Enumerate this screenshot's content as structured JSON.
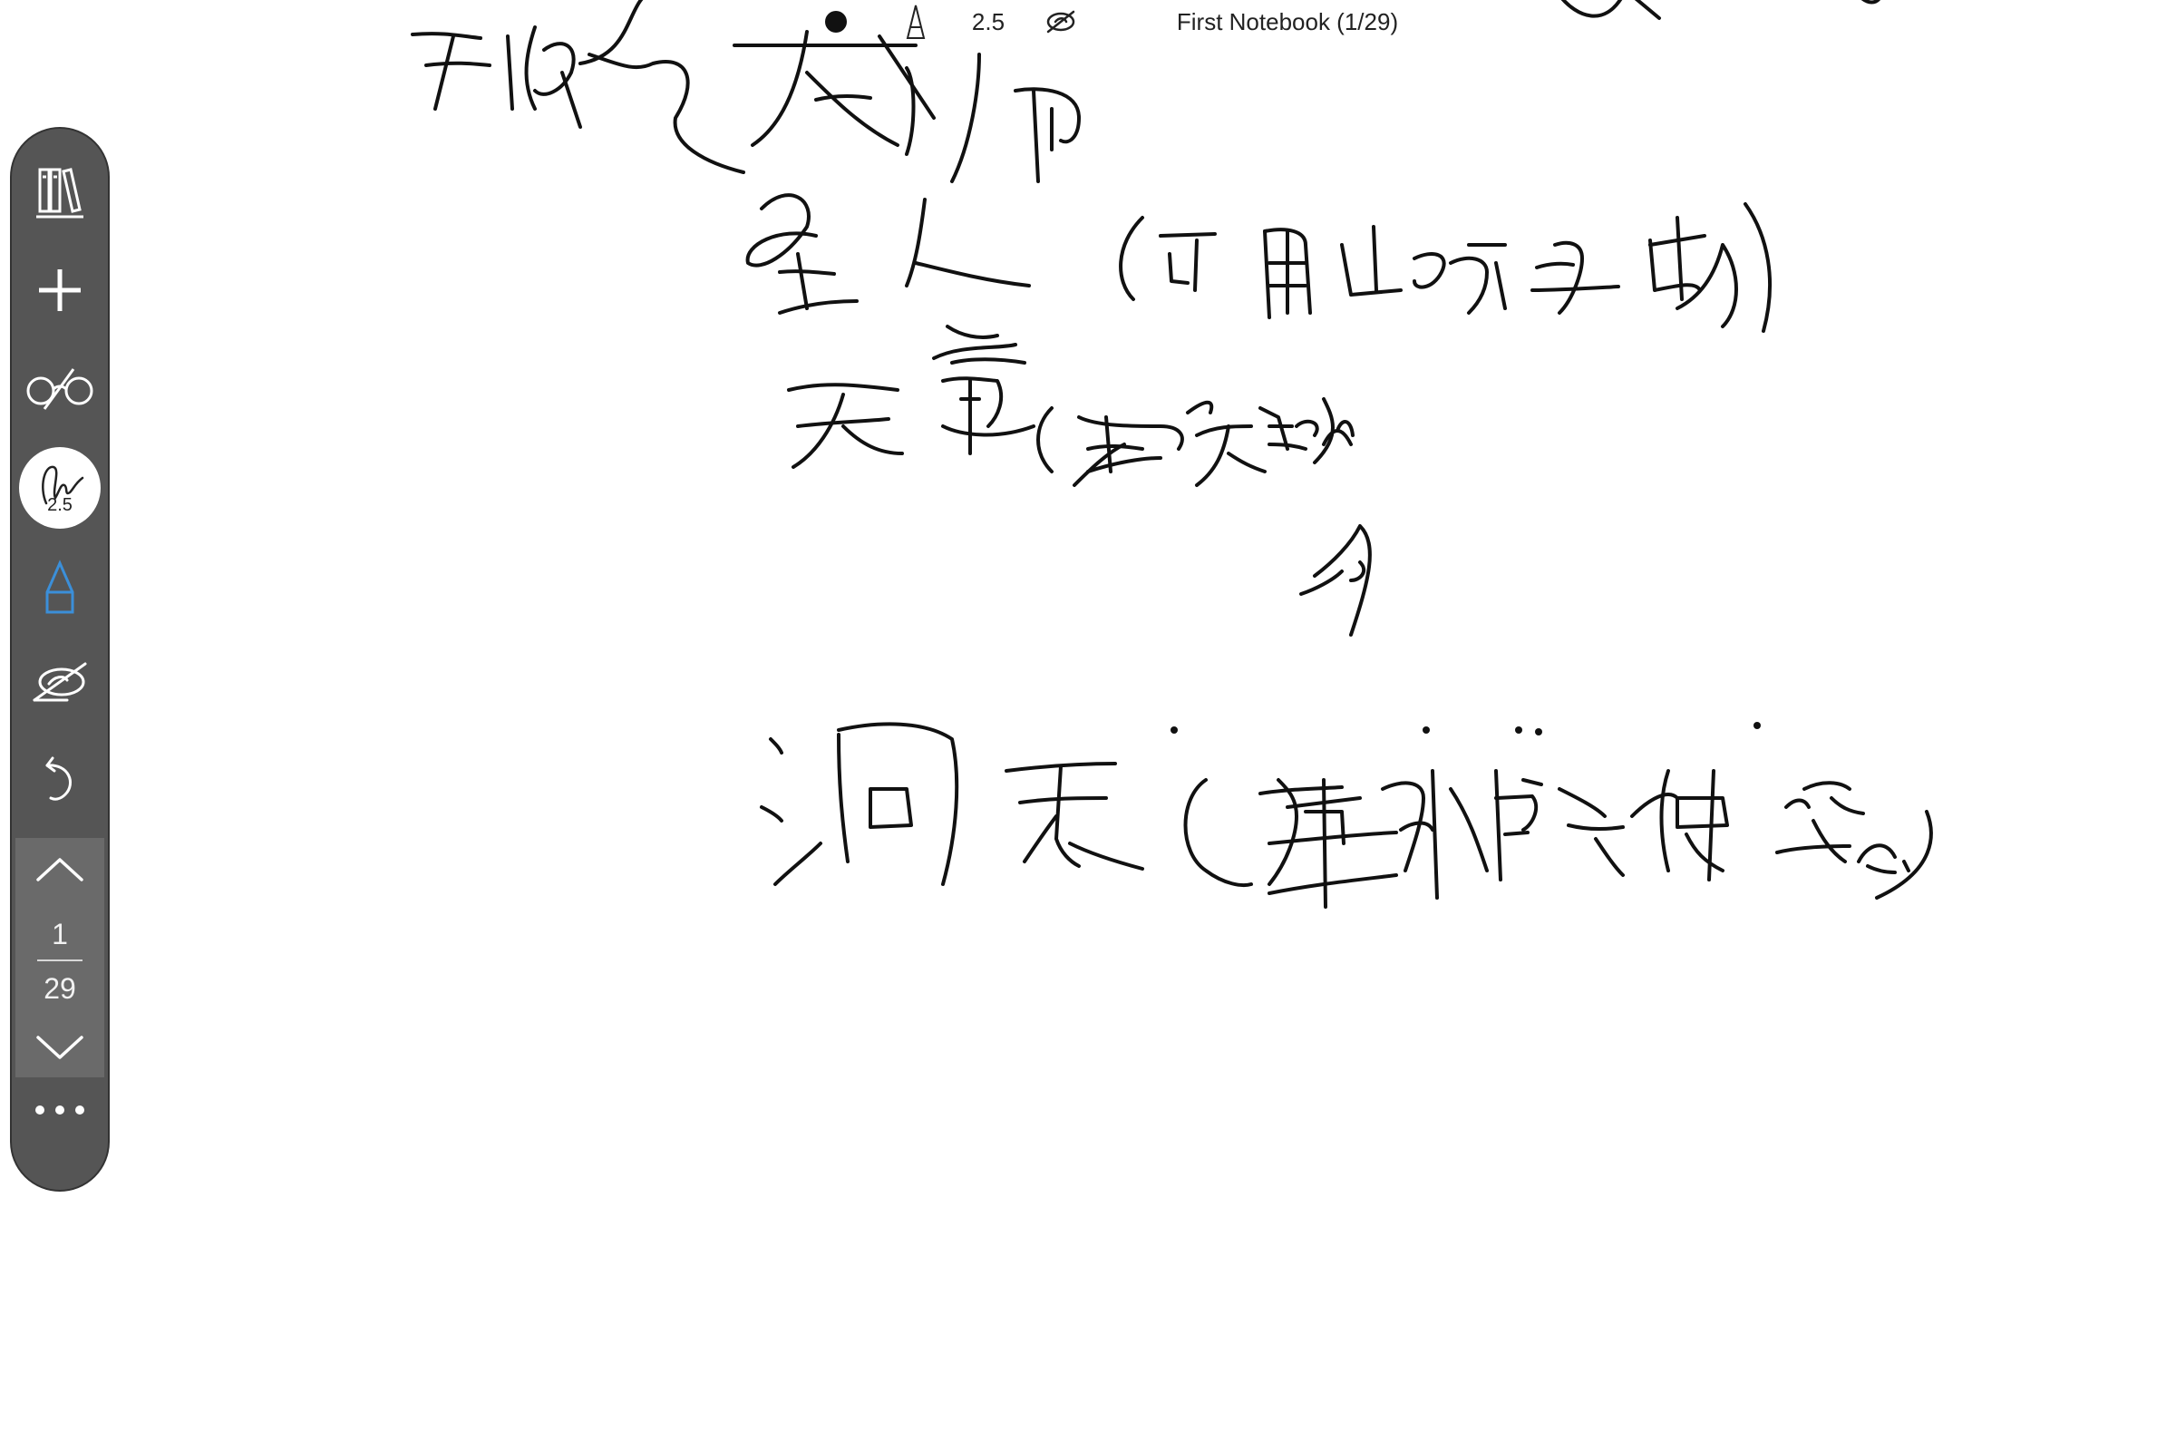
{
  "status_bar": {
    "pen_size": "2.5",
    "notebook_title": "First Notebook (1/29)"
  },
  "toolbar": {
    "items": [
      {
        "name": "library",
        "icon": "books-icon"
      },
      {
        "name": "add",
        "icon": "plus-icon"
      },
      {
        "name": "view",
        "icon": "glasses-icon"
      },
      {
        "name": "pen",
        "icon": "pen-signature-icon",
        "size_label": "2.5"
      },
      {
        "name": "highlighter",
        "icon": "highlighter-icon",
        "color": "#3b8fd9"
      },
      {
        "name": "eraser",
        "icon": "eraser-icon"
      },
      {
        "name": "undo",
        "icon": "undo-icon"
      }
    ],
    "pagination": {
      "current": "1",
      "total": "29"
    },
    "more": {
      "icon": "more-icon"
    }
  },
  "colors": {
    "toolbar_bg": "#555555",
    "ink": "#111111",
    "accent": "#3b8fd9"
  }
}
